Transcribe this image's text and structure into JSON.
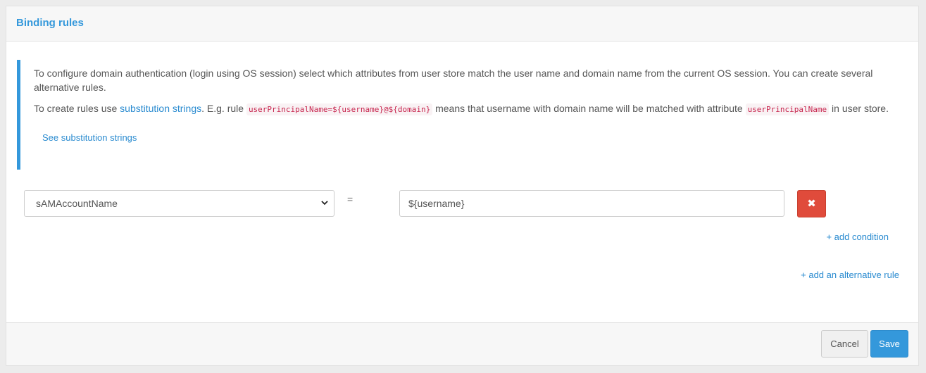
{
  "panel": {
    "title": "Binding rules"
  },
  "info": {
    "p1": "To configure domain authentication (login using OS session) select which attributes from user store match the user name and domain name from the current OS session. You can create several alternative rules.",
    "p2_prefix": "To create rules use ",
    "p2_link": "substitution strings",
    "p2_mid1": ". E.g. rule ",
    "p2_code1": "userPrincipalName=${username}@${domain}",
    "p2_mid2": " means that username with domain name will be matched with attribute ",
    "p2_code2": "userPrincipalName",
    "p2_suffix": " in user store.",
    "see_link": "See substitution strings"
  },
  "rule": {
    "attribute": "sAMAccountName",
    "operator": "=",
    "value": "${username}",
    "delete_icon": "times-icon",
    "add_condition": "+ add condition"
  },
  "add_alternative": "+ add an alternative rule",
  "footer": {
    "cancel": "Cancel",
    "save": "Save"
  },
  "colors": {
    "accent": "#3498db",
    "danger": "#e04b3b"
  }
}
